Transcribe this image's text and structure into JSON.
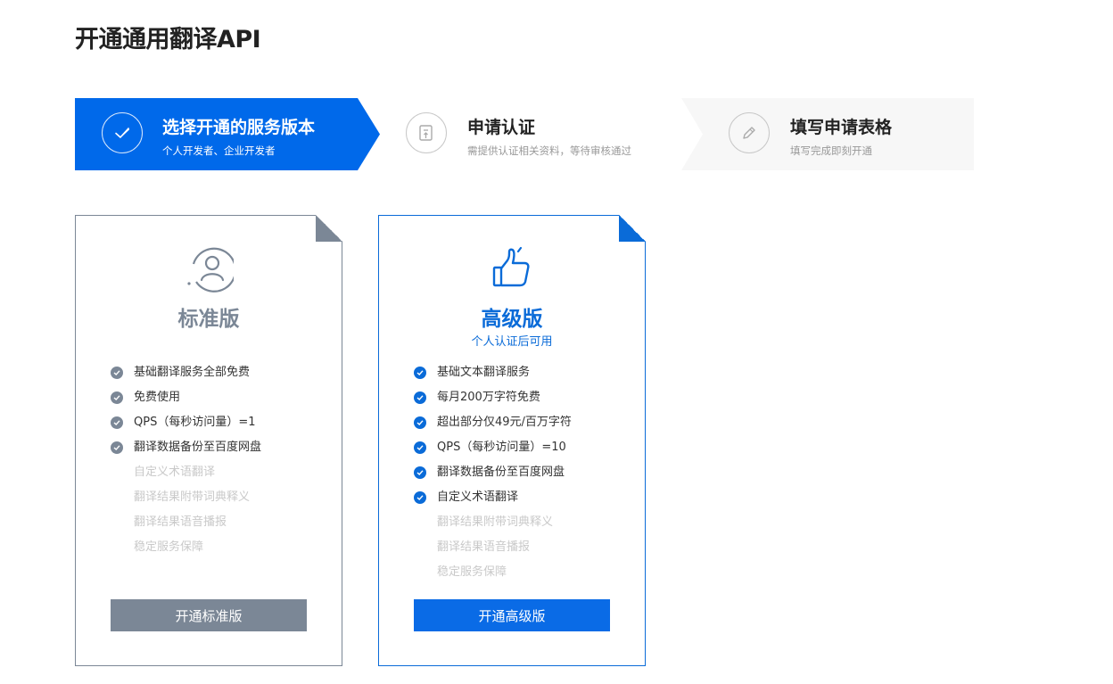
{
  "page_title": "开通通用翻译API",
  "colors": {
    "accent": "#0a6bd8",
    "standard_gray": "#7b8796",
    "disabled_text": "#c9c9c9"
  },
  "steps": [
    {
      "title": "选择开通的服务版本",
      "subtitle": "个人开发者、企业开发者",
      "icon": "check-icon",
      "active": true
    },
    {
      "title": "申请认证",
      "subtitle": "需提供认证相关资料，等待审核通过",
      "icon": "document-upload-icon",
      "active": false
    },
    {
      "title": "填写申请表格",
      "subtitle": "填写完成即刻开通",
      "icon": "pencil-icon",
      "active": false
    }
  ],
  "plans": {
    "standard": {
      "name": "标准版",
      "icon": "user-icon",
      "features_enabled": [
        "基础翻译服务全部免费",
        "免费使用",
        "QPS（每秒访问量）=1",
        "翻译数据备份至百度网盘"
      ],
      "features_disabled": [
        "自定义术语翻译",
        "翻译结果附带词典释义",
        "翻译结果语音播报",
        "稳定服务保障"
      ],
      "button": "开通标准版"
    },
    "premium": {
      "name": "高级版",
      "note": "个人认证后可用",
      "icon": "thumbs-up-icon",
      "features_enabled": [
        "基础文本翻译服务",
        "每月200万字符免费",
        "超出部分仅49元/百万字符",
        "QPS（每秒访问量）=10",
        "翻译数据备份至百度网盘",
        "自定义术语翻译"
      ],
      "features_disabled": [
        "翻译结果附带词典释义",
        "翻译结果语音播报",
        "稳定服务保障"
      ],
      "button": "开通高级版"
    }
  }
}
